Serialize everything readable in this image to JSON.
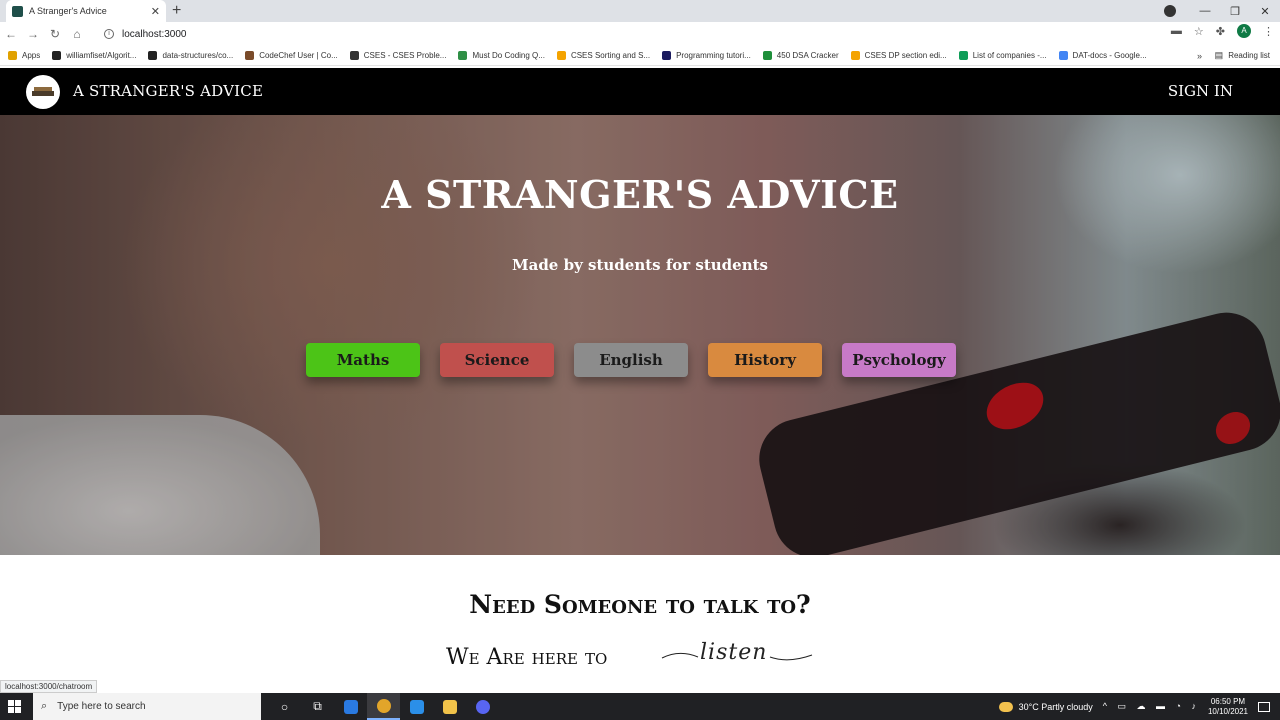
{
  "browser": {
    "tab_title": "A Stranger's Advice",
    "tab_close": "✕",
    "new_tab": "+",
    "url": "localhost:3000",
    "status_url": "localhost:3000/chatroom",
    "window_controls": [
      "—",
      "❐",
      "✕"
    ],
    "bookmarks": [
      {
        "label": "Apps",
        "color": "#e0a100"
      },
      {
        "label": "williamfiset/Algorit...",
        "color": "#222222"
      },
      {
        "label": "data-structures/co...",
        "color": "#222222"
      },
      {
        "label": "CodeChef User | Co...",
        "color": "#7a4b2a"
      },
      {
        "label": "CSES - CSES Proble...",
        "color": "#333333"
      },
      {
        "label": "Must Do Coding Q...",
        "color": "#2f8f46"
      },
      {
        "label": "CSES Sorting and S...",
        "color": "#f4a300"
      },
      {
        "label": "Programming tutori...",
        "color": "#1a1a5e"
      },
      {
        "label": "450 DSA Cracker",
        "color": "#1e8f3a"
      },
      {
        "label": "CSES DP section edi...",
        "color": "#f4a300"
      },
      {
        "label": "List of companies -...",
        "color": "#0f9d58"
      },
      {
        "label": "DAT-docs - Google...",
        "color": "#4285f4"
      }
    ],
    "bookmarks_more": "»",
    "reading_list": "Reading list",
    "profile_initial": "A"
  },
  "site": {
    "brand": "A STRANGER'S ADVICE",
    "sign_in": "SIGN IN",
    "hero_title": "A STRANGER'S ADVICE",
    "hero_subtitle": "Made by students for students",
    "subjects": [
      {
        "label": "Maths",
        "color": "#4cc417"
      },
      {
        "label": "Science",
        "color": "#c0504d"
      },
      {
        "label": "English",
        "color": "#8c8c8c"
      },
      {
        "label": "History",
        "color": "#d98a3f"
      },
      {
        "label": "Psychology",
        "color": "#c77ac7"
      }
    ],
    "need_heading": "Need Someone to talk to?",
    "here_text": "We Are here to",
    "listen_word": "listen"
  },
  "taskbar": {
    "search_placeholder": "Type here to search",
    "weather": "30°C  Partly cloudy",
    "time": "06:50 PM",
    "date": "10/10/2021"
  }
}
